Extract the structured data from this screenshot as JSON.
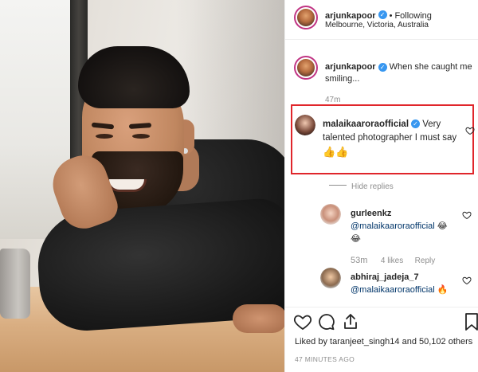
{
  "post": {
    "author": "arjunkapoor",
    "follow_status": "Following",
    "location": "Melbourne, Victoria, Australia"
  },
  "caption": {
    "username": "arjunkapoor",
    "text_line1": "When she caught me",
    "text_line2": "smiling...",
    "time": "47m"
  },
  "comments": [
    {
      "username": "malaikaaroraofficial",
      "text_inline": "Very",
      "text_line2": "talented photographer I must say",
      "emoji": "👍👍",
      "hide_replies": "Hide replies"
    }
  ],
  "replies": [
    {
      "username": "gurleenkz",
      "mention": "@malaikaaroraofficial",
      "emoji_inline": "😂",
      "emoji_line2": "😂",
      "time": "53m",
      "likes": "4 likes",
      "reply_label": "Reply"
    },
    {
      "username": "abhiraj_jadeja_7",
      "mention": "@malaikaaroraofficial",
      "emoji": "🔥"
    }
  ],
  "likes": {
    "prefix": "Liked by",
    "user": "taranjeet_singh14",
    "conj": "and",
    "count": "50,102 others"
  },
  "timestamp": "47 MINUTES AGO",
  "colors": {
    "verified": "#3897f0",
    "highlight": "#e0262b",
    "muted": "#8e8e8e"
  },
  "icons": [
    "heart-icon",
    "comment-icon",
    "share-icon",
    "bookmark-icon",
    "verified-badge-icon"
  ]
}
